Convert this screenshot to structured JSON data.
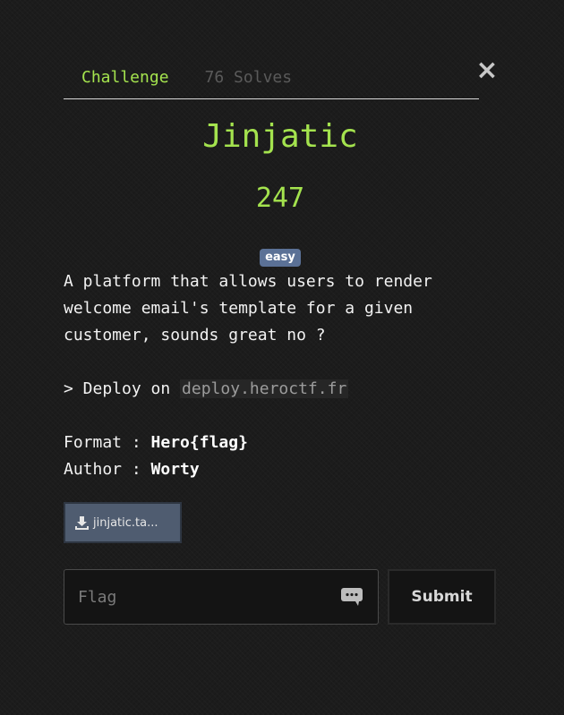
{
  "tabs": [
    {
      "label": "Challenge"
    },
    {
      "label": "76 Solves"
    }
  ],
  "challenge": {
    "name": "Jinjatic",
    "points": "247",
    "difficulty": "easy",
    "description_lines": [
      "A platform that allows users to render",
      "welcome email's template for a given",
      "customer, sounds great no ?"
    ],
    "deploy_prefix": "> Deploy on ",
    "deploy_host": "deploy.heroctf.fr",
    "format_label": "Format : ",
    "format_value": "Hero{flag}",
    "author_label": "Author : ",
    "author_value": "Worty",
    "file_label": "jinjatic.ta..."
  },
  "form": {
    "flag_placeholder": "Flag",
    "submit_label": "Submit"
  },
  "icons": {
    "close": "close-icon",
    "download": "download-icon",
    "chat": "chat-icon"
  },
  "colors": {
    "accent": "#a4e34e",
    "badge": "#5b7196"
  }
}
